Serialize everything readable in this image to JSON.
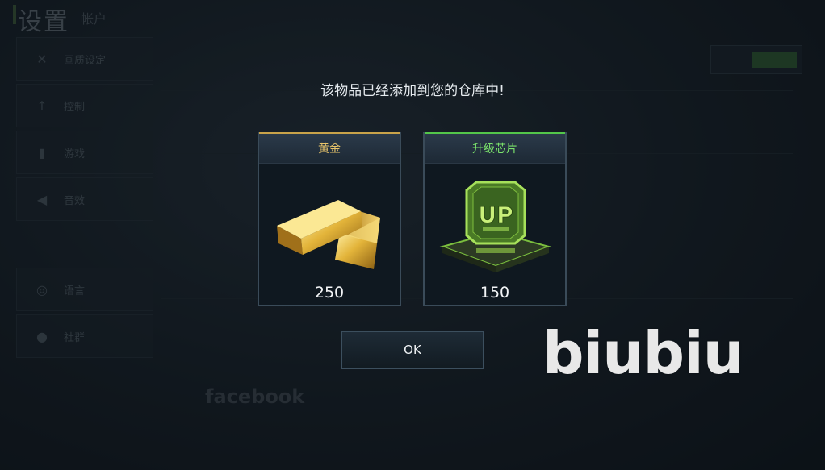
{
  "background": {
    "title": "设置",
    "title_sub": "帐户",
    "sidebar": [
      {
        "label": "画质设定",
        "icon": "tools-icon"
      },
      {
        "label": "控制",
        "icon": "arrow-up-icon"
      },
      {
        "label": "游戏",
        "icon": "tower-icon"
      },
      {
        "label": "音效",
        "icon": "speaker-icon"
      },
      {
        "label": "语言",
        "icon": "globe-icon"
      },
      {
        "label": "社群",
        "icon": "people-icon"
      }
    ],
    "facebook": "facebook"
  },
  "dialog": {
    "message": "该物品已经添加到您的仓库中!",
    "items": [
      {
        "name": "黄金",
        "amount": "250",
        "icon": "gold-bar-icon"
      },
      {
        "name": "升级芯片",
        "amount": "150",
        "icon": "upgrade-chip-icon"
      }
    ],
    "ok_label": "OK"
  },
  "watermark": "biubiu",
  "colors": {
    "gold_accent": "#c9a34a",
    "chip_accent": "#53c64a",
    "panel_border": "#3a4b59"
  }
}
